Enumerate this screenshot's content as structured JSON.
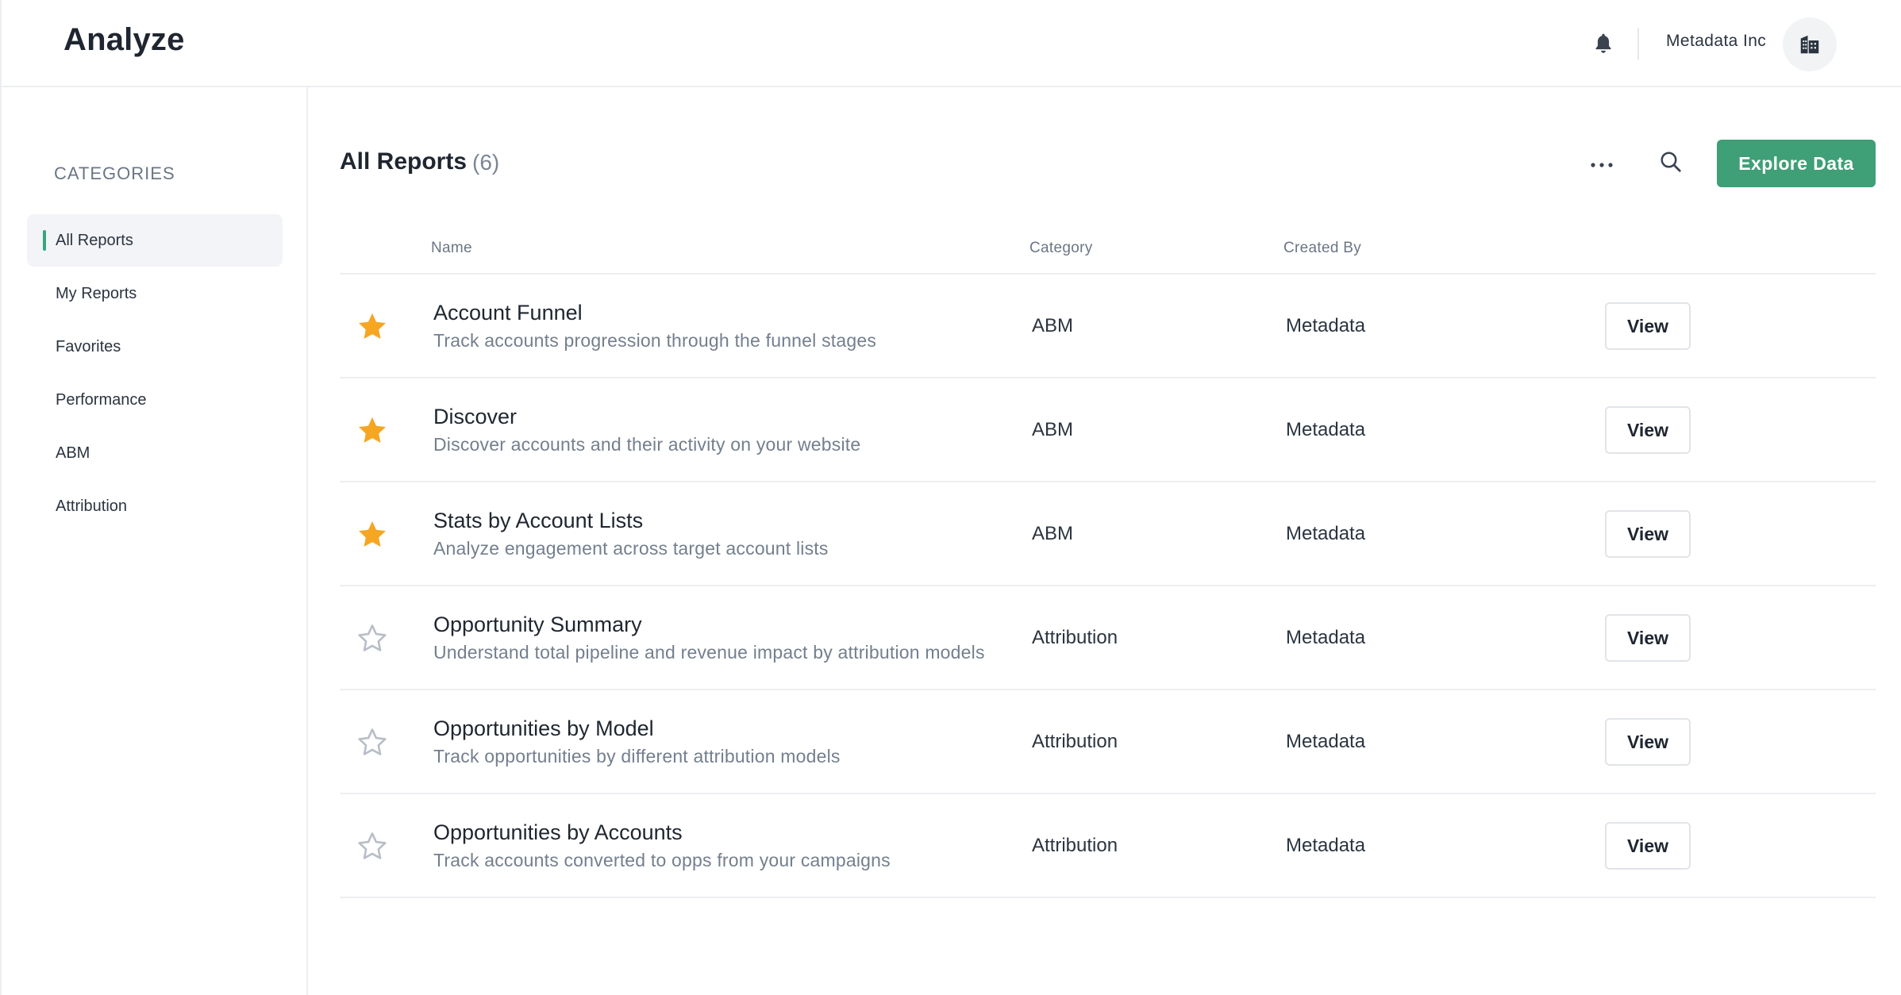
{
  "header": {
    "title": "Analyze",
    "org_name": "Metadata Inc",
    "icons": {
      "notifications": "bell-icon",
      "org": "building-icon"
    }
  },
  "sidebar": {
    "heading": "CATEGORIES",
    "items": [
      {
        "label": "All Reports",
        "active": true
      },
      {
        "label": "My Reports",
        "active": false
      },
      {
        "label": "Favorites",
        "active": false
      },
      {
        "label": "Performance",
        "active": false
      },
      {
        "label": "ABM",
        "active": false
      },
      {
        "label": "Attribution",
        "active": false
      }
    ]
  },
  "main": {
    "title": "All Reports",
    "count": "(6)",
    "explore_label": "Explore Data",
    "icons": {
      "more": "more-horizontal-icon",
      "search": "search-icon"
    },
    "columns": {
      "name": "Name",
      "category": "Category",
      "created_by": "Created By"
    },
    "view_label": "View",
    "rows": [
      {
        "title": "Account Funnel",
        "description": "Track accounts progression through the funnel stages",
        "category": "ABM",
        "created_by": "Metadata",
        "favorite": true
      },
      {
        "title": "Discover",
        "description": "Discover accounts and their activity on your website",
        "category": "ABM",
        "created_by": "Metadata",
        "favorite": true
      },
      {
        "title": "Stats by Account Lists",
        "description": "Analyze engagement across target account lists",
        "category": "ABM",
        "created_by": "Metadata",
        "favorite": true
      },
      {
        "title": "Opportunity Summary",
        "description": "Understand total pipeline and revenue impact by attribution models",
        "category": "Attribution",
        "created_by": "Metadata",
        "favorite": false
      },
      {
        "title": "Opportunities by Model",
        "description": "Track opportunities by different attribution models",
        "category": "Attribution",
        "created_by": "Metadata",
        "favorite": false
      },
      {
        "title": "Opportunities by Accounts",
        "description": "Track accounts converted to opps from your campaigns",
        "category": "Attribution",
        "created_by": "Metadata",
        "favorite": false
      }
    ]
  },
  "colors": {
    "accent": "#3f9f76",
    "star_filled": "#f5a623",
    "star_empty": "#b8bec8",
    "active_indicator": "#3aa57a"
  }
}
